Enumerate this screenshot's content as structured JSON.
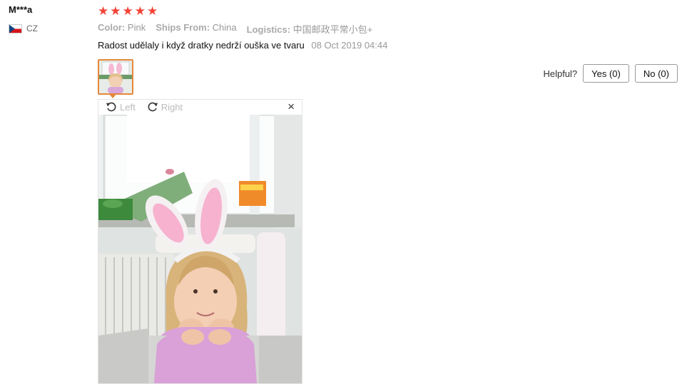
{
  "review": {
    "user_name": "M***a",
    "country_code": "CZ",
    "stars": [
      "★",
      "★",
      "★",
      "★",
      "★"
    ],
    "attributes": [
      {
        "key": "Color:",
        "value": "Pink"
      },
      {
        "key": "Ships From:",
        "value": "China"
      },
      {
        "key": "Logistics:",
        "value": "中国邮政平常小包+"
      }
    ],
    "text": "Radost udělaly i když dratky nedrží ouška ve tvaru",
    "date": "08 Oct 2019 04:44"
  },
  "helpful": {
    "label": "Helpful?",
    "yes": "Yes (0)",
    "no": "No (0)"
  },
  "viewer": {
    "rotate_left": "Left",
    "rotate_right": "Right",
    "close": "×"
  },
  "colors": {
    "star": "#f44336",
    "thumb_border": "#e5883a"
  }
}
